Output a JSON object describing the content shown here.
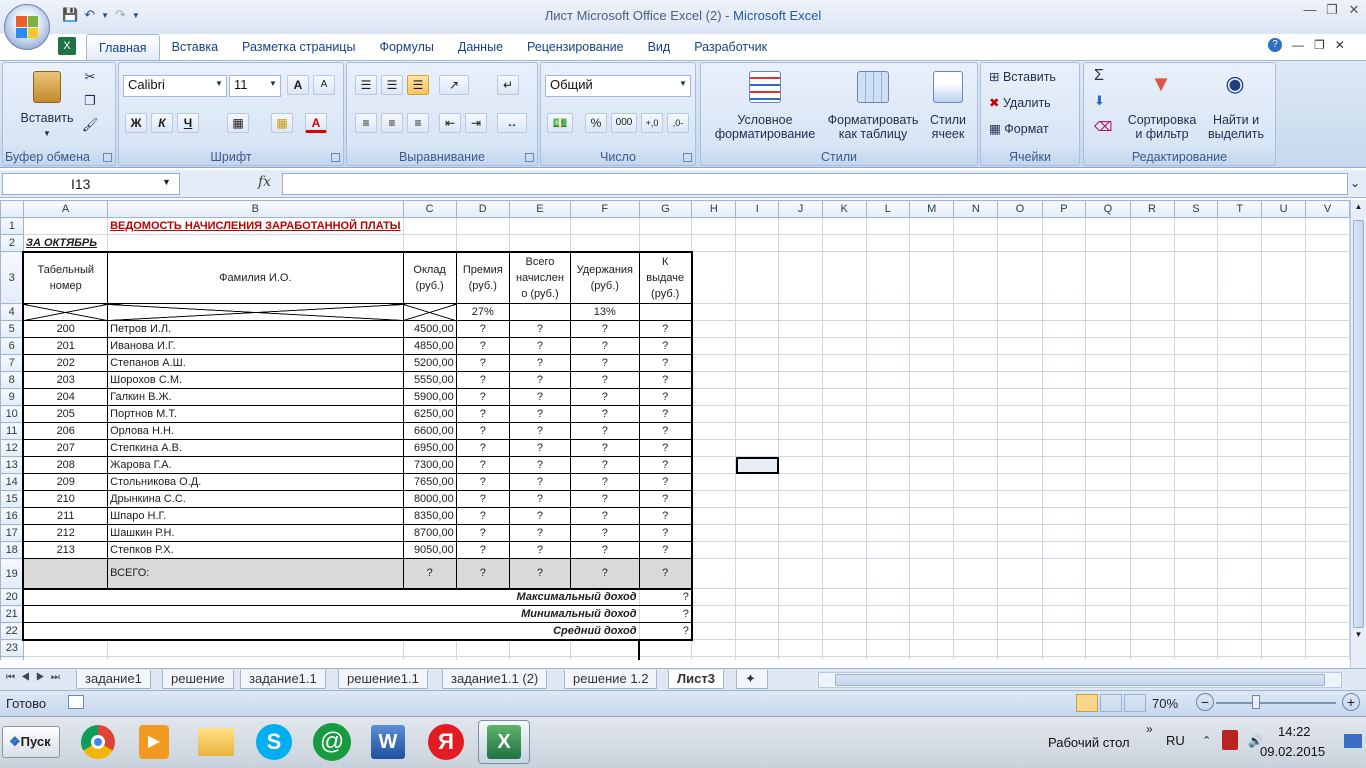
{
  "window": {
    "title": "Лист Microsoft Office Excel (2)",
    "title_sep": " - ",
    "app_name": "Microsoft Excel"
  },
  "ribbon_tabs": [
    "Главная",
    "Вставка",
    "Разметка страницы",
    "Формулы",
    "Данные",
    "Рецензирование",
    "Вид",
    "Разработчик"
  ],
  "clipboard": {
    "paste": "Вставить",
    "label": "Буфер обмена"
  },
  "font": {
    "name": "Calibri",
    "size": "11",
    "bold": "Ж",
    "italic": "К",
    "underline": "Ч",
    "grow": "A",
    "shrink": "A",
    "color_a": "A",
    "label": "Шрифт"
  },
  "alignment": {
    "label": "Выравнивание"
  },
  "number": {
    "format": "Общий",
    "percent": "%",
    "thousands": "000",
    "label": "Число"
  },
  "styles": {
    "conditional_1": "Условное",
    "conditional_2": "форматирование",
    "as_table_1": "Форматировать",
    "as_table_2": "как таблицу",
    "cell_styles_1": "Стили",
    "cell_styles_2": "ячеек",
    "label": "Стили"
  },
  "cells_group": {
    "insert": "Вставить",
    "delete": "Удалить",
    "format": "Формат",
    "label": "Ячейки"
  },
  "editing": {
    "sigma": "Σ",
    "sort_1": "Сортировка",
    "sort_2": "и фильтр",
    "find_1": "Найти и",
    "find_2": "выделить",
    "label": "Редактирование"
  },
  "formula_bar": {
    "name_box": "I13",
    "fx": "fx",
    "formula": ""
  },
  "columns": [
    "A",
    "B",
    "C",
    "D",
    "E",
    "F",
    "G",
    "H",
    "I",
    "J",
    "K",
    "L",
    "M",
    "N",
    "O",
    "P",
    "Q",
    "R",
    "S",
    "T",
    "U",
    "V"
  ],
  "sheet": {
    "title": "ВЕДОМОСТЬ НАЧИСЛЕНИЯ ЗАРАБОТАННОЙ ПЛАТЫ",
    "subtitle": "ЗА ОКТЯБРЬ",
    "headers": {
      "a_1": "Табельный",
      "a_2": "номер",
      "b": "Фамилия И.О.",
      "c_1": "Оклад",
      "c_2": "(руб.)",
      "d_1": "Премия",
      "d_2": "(руб.)",
      "e_1": "Всего",
      "e_2": "начислен",
      "e_3": "о (руб.)",
      "f_1": "Удержания",
      "f_2": "(руб.)",
      "g_1": "К выдаче",
      "g_2": "(руб.)"
    },
    "bonus_pct": "27%",
    "deduction_pct": "13%",
    "rows": [
      {
        "n": "200",
        "name": "Петров И.Л.",
        "salary": "4500,00"
      },
      {
        "n": "201",
        "name": "Иванова И.Г.",
        "salary": "4850,00"
      },
      {
        "n": "202",
        "name": "Степанов А.Ш.",
        "salary": "5200,00"
      },
      {
        "n": "203",
        "name": "Шорохов С.М.",
        "salary": "5550,00"
      },
      {
        "n": "204",
        "name": "Галкин В.Ж.",
        "salary": "5900,00"
      },
      {
        "n": "205",
        "name": "Портнов М.Т.",
        "salary": "6250,00"
      },
      {
        "n": "206",
        "name": "Орлова Н.Н.",
        "salary": "6600,00"
      },
      {
        "n": "207",
        "name": "Степкина А.В.",
        "salary": "6950,00"
      },
      {
        "n": "208",
        "name": "Жарова  Г.А.",
        "salary": "7300,00"
      },
      {
        "n": "209",
        "name": "Стольникова О.Д.",
        "salary": "7650,00"
      },
      {
        "n": "210",
        "name": "Дрынкина С.С.",
        "salary": "8000,00"
      },
      {
        "n": "211",
        "name": "Шпаро Н.Г.",
        "salary": "8350,00"
      },
      {
        "n": "212",
        "name": "Шашкин Р.Н.",
        "salary": "8700,00"
      },
      {
        "n": "213",
        "name": "Степков Р.Х.",
        "salary": "9050,00"
      }
    ],
    "unknown": "?",
    "total_label": "ВСЕГО:",
    "max_label": "Максимальный доход",
    "min_label": "Минимальный доход",
    "avg_label": "Средний доход"
  },
  "sheet_tabs": [
    "задание1",
    "решение",
    "задание1.1",
    "решение1.1",
    "задание1.1 (2)",
    "решение 1.2",
    "Лист3"
  ],
  "status": {
    "ready": "Готово",
    "zoom": "70%"
  },
  "taskbar": {
    "start": "Пуск",
    "desktop": "Рабочий стол",
    "lang": "RU",
    "time": "14:22",
    "date": "09.02.2015"
  }
}
